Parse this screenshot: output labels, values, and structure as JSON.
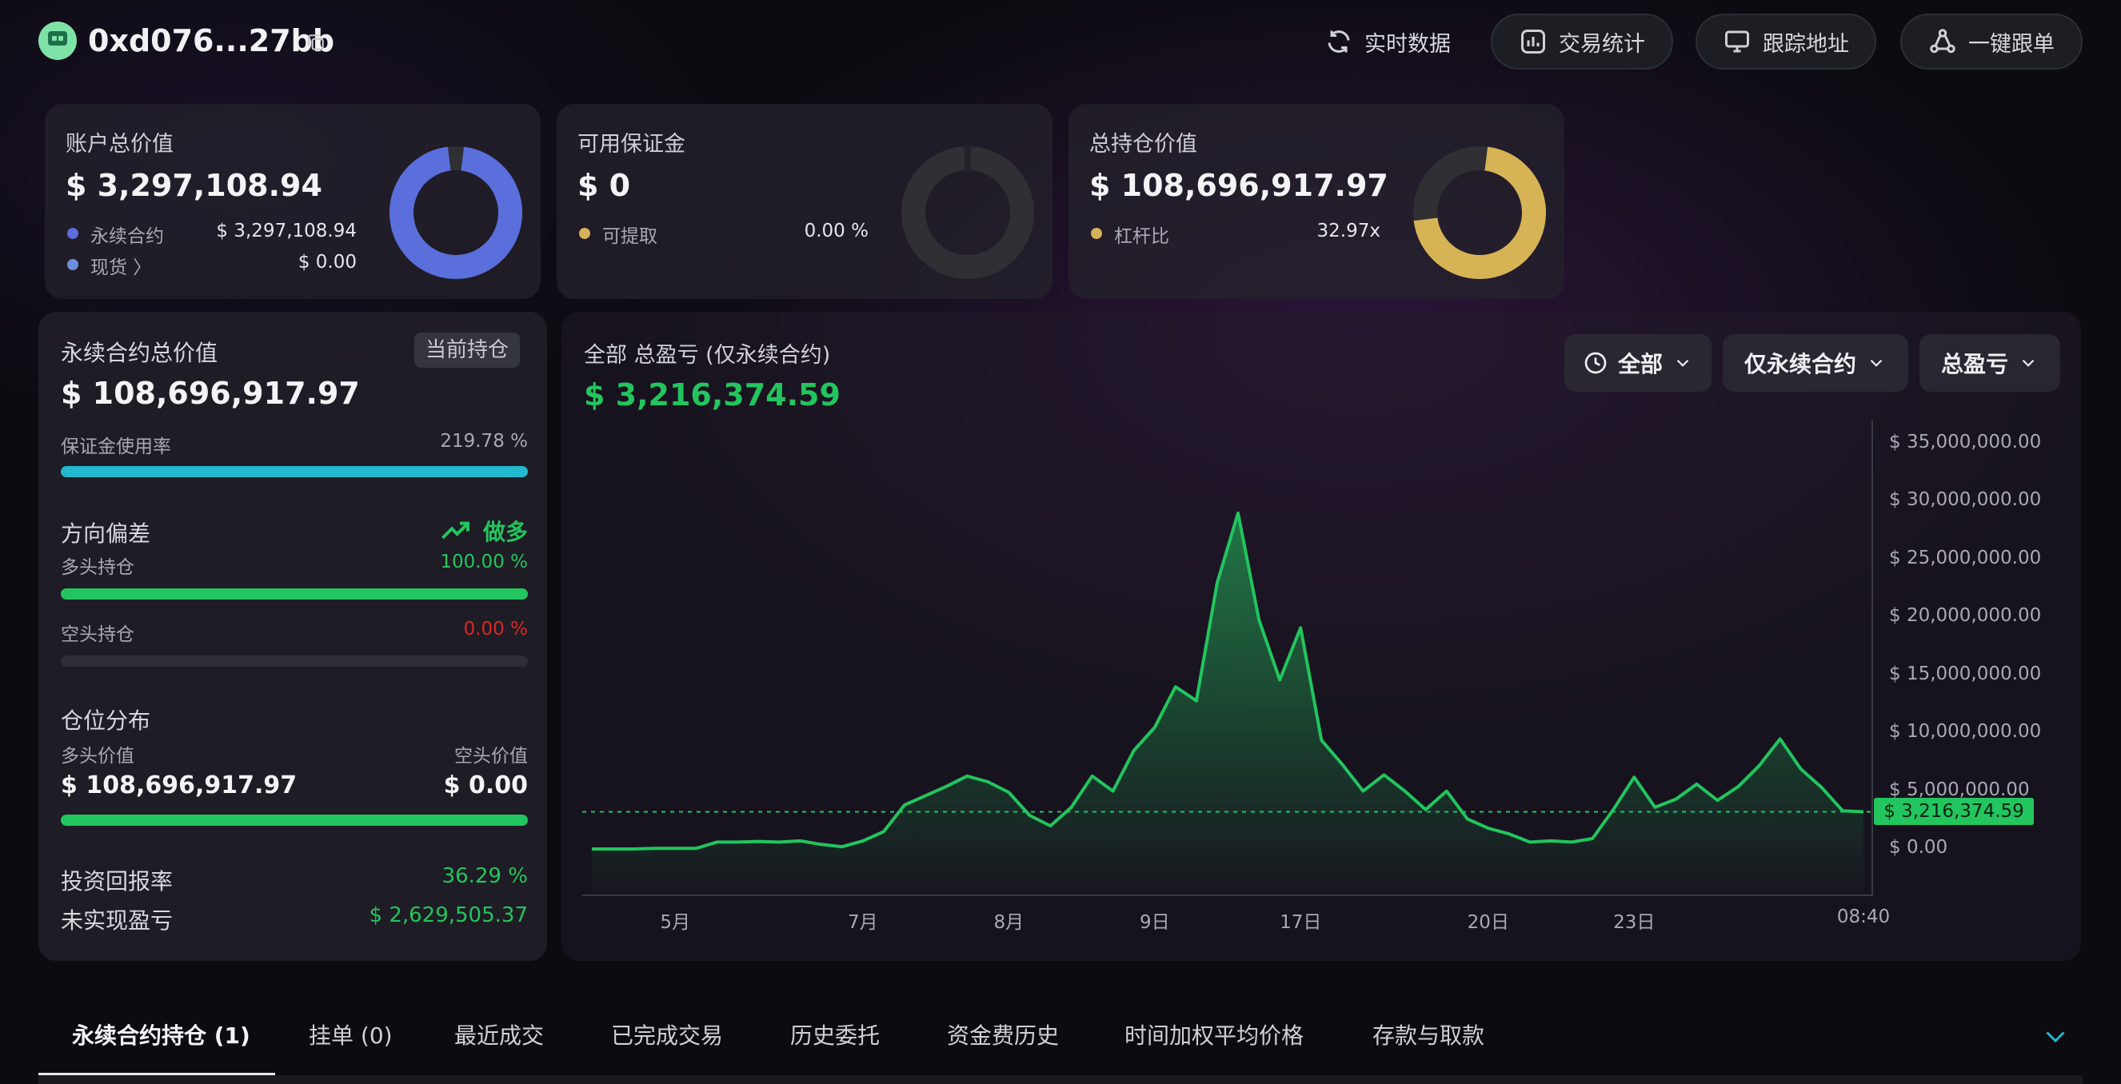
{
  "header": {
    "address": "0xd076...27bb",
    "buttons": [
      {
        "label": "实时数据",
        "icon": "refresh-icon"
      },
      {
        "label": "交易统计",
        "icon": "stats-icon"
      },
      {
        "label": "跟踪地址",
        "icon": "monitor-icon"
      },
      {
        "label": "一键跟单",
        "icon": "share-icon"
      }
    ]
  },
  "summary": {
    "account": {
      "label": "账户总价值",
      "value": "$ 3,297,108.94",
      "rows": [
        {
          "label": "永续合约",
          "value": "$ 3,297,108.94",
          "color": "#5b6cdb"
        },
        {
          "label": "现货 〉",
          "value": "$ 0.00",
          "color": "#6a8fe0"
        }
      ],
      "donut_color": "#5a6fdc",
      "donut_fraction": 1.0
    },
    "margin": {
      "label": "可用保证金",
      "value": "$ 0",
      "rows": [
        {
          "label": "可提取",
          "value": "0.00 %",
          "color": "#d4b15a"
        }
      ],
      "donut_color": "#2f2f34",
      "donut_fraction": 0.0
    },
    "position": {
      "label": "总持仓价值",
      "value": "$ 108,696,917.97",
      "rows": [
        {
          "label": "杠杆比",
          "value": "32.97x",
          "color": "#d4b15a"
        }
      ],
      "donut_color": "#d6b456",
      "donut_fraction": 0.75
    }
  },
  "perp": {
    "title": "永续合约总价值",
    "badge": "当前持仓",
    "value": "$ 108,696,917.97",
    "margin_usage_label": "保证金使用率",
    "margin_usage_value": "219.78 %",
    "margin_usage_fraction": 1.0,
    "bias_label": "方向偏差",
    "bias_value": "做多",
    "long_label": "多头持仓",
    "long_value": "100.00 %",
    "long_fraction": 1.0,
    "short_label": "空头持仓",
    "short_value": "0.00 %",
    "short_fraction": 0.0,
    "dist_label": "仓位分布",
    "long_value_label": "多头价值",
    "short_value_label": "空头价值",
    "long_amount": "$ 108,696,917.97",
    "short_amount": "$ 0.00",
    "dist_fraction": 1.0,
    "roi_label": "投资回报率",
    "roi_value": "36.29 %",
    "upnl_label": "未实现盈亏",
    "upnl_value": "$ 2,629,505.37"
  },
  "pnl": {
    "title": "全部 总盈亏 (仅永续合约)",
    "value": "$ 3,216,374.59",
    "dropdowns": [
      "全部",
      "仅永续合约",
      "总盈亏"
    ],
    "current_badge": "$ 3,216,374.59"
  },
  "chart_data": {
    "type": "area",
    "title": "",
    "xlabel": "",
    "ylabel": "",
    "ylim": [
      -4000000,
      37000000
    ],
    "yticks": [
      "$ 35,000,000.00",
      "$ 30,000,000.00",
      "$ 25,000,000.00",
      "$ 20,000,000.00",
      "$ 15,000,000.00",
      "$ 10,000,000.00",
      "$ 5,000,000.00",
      "$ 0.00"
    ],
    "ytick_values": [
      35000000,
      30000000,
      25000000,
      20000000,
      15000000,
      10000000,
      5000000,
      0
    ],
    "xticks": [
      "5月",
      "7月",
      "8月",
      "9日",
      "17日",
      "20日",
      "23日",
      "08:40"
    ],
    "xtick_positions": [
      4,
      13,
      20,
      27,
      34,
      43,
      50,
      61
    ],
    "current_value": 3216374.59,
    "line_color": "#22c55e",
    "values": [
      0,
      0,
      0,
      50000,
      50000,
      50000,
      600000,
      600000,
      650000,
      600000,
      700000,
      400000,
      200000,
      700000,
      1500000,
      3800000,
      4600000,
      5400000,
      6300000,
      5800000,
      4900000,
      2900000,
      2000000,
      3600000,
      6300000,
      5000000,
      8500000,
      10500000,
      14000000,
      12800000,
      23000000,
      29000000,
      19800000,
      14600000,
      19100000,
      9400000,
      7300000,
      5000000,
      6400000,
      5000000,
      3400000,
      5000000,
      2600000,
      1800000,
      1300000,
      600000,
      700000,
      600000,
      900000,
      3400000,
      6200000,
      3600000,
      4300000,
      5600000,
      4200000,
      5400000,
      7200000,
      9500000,
      6900000,
      5300000,
      3300000,
      3216374
    ]
  },
  "tabs": [
    "永续合约持仓 (1)",
    "挂单 (0)",
    "最近成交",
    "已完成交易",
    "历史委托",
    "资金费历史",
    "时间加权平均价格",
    "存款与取款"
  ],
  "colors": {
    "green": "#22c55e",
    "red": "#dc2626",
    "cyan": "#22b8cf"
  }
}
